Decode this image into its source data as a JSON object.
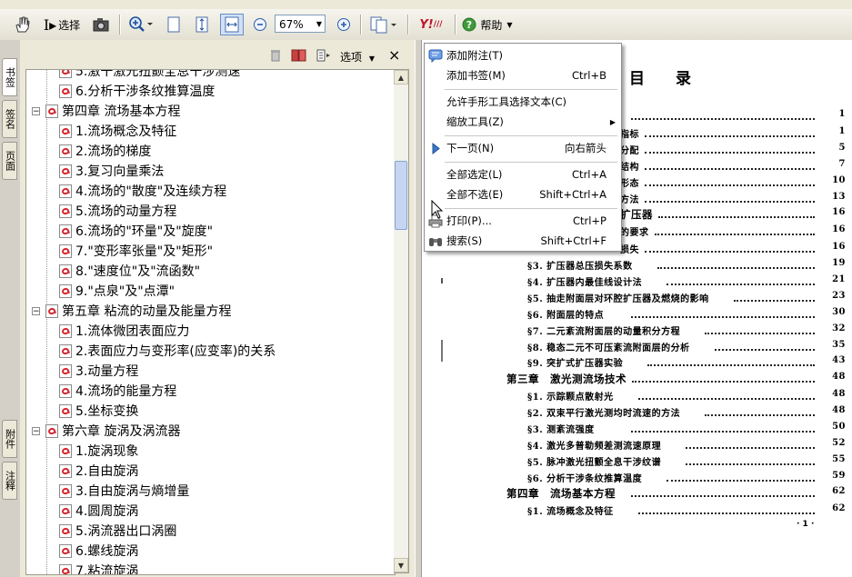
{
  "toolbar": {
    "select_label": "选择",
    "zoom_value": "67%",
    "help_label": "帮助"
  },
  "side_tabs": [
    "书签",
    "签名",
    "页面",
    "附件",
    "注释"
  ],
  "panel": {
    "options_label": "选项",
    "close_glyph": "×",
    "tree": [
      {
        "level": 1,
        "text": "5.激干激光扭颤全息干涉测速"
      },
      {
        "level": 1,
        "text": "6.分析干涉条纹推算温度"
      },
      {
        "level": 0,
        "text": "第四章 流场基本方程"
      },
      {
        "level": 1,
        "text": "1.流场概念及特征"
      },
      {
        "level": 1,
        "text": "2.流场的梯度"
      },
      {
        "level": 1,
        "text": "3.复习向量乘法"
      },
      {
        "level": 1,
        "text": "4.流场的\"散度\"及连续方程"
      },
      {
        "level": 1,
        "text": "5.流场的动量方程"
      },
      {
        "level": 1,
        "text": "6.流场的\"环量\"及\"旋度\""
      },
      {
        "level": 1,
        "text": "7.\"变形率张量\"及\"矩形\""
      },
      {
        "level": 1,
        "text": "8.\"速度位\"及\"流函数\""
      },
      {
        "level": 1,
        "text": "9.\"点泉\"及\"点潭\""
      },
      {
        "level": 0,
        "text": "第五章 粘流的动量及能量方程"
      },
      {
        "level": 1,
        "text": "1.流体微团表面应力"
      },
      {
        "level": 1,
        "text": "2.表面应力与变形率(应变率)的关系"
      },
      {
        "level": 1,
        "text": "3.动量方程"
      },
      {
        "level": 1,
        "text": "4.流场的能量方程"
      },
      {
        "level": 1,
        "text": "5.坐标变换"
      },
      {
        "level": 0,
        "text": "第六章 旋涡及涡流器"
      },
      {
        "level": 1,
        "text": "1.旋涡现象"
      },
      {
        "level": 1,
        "text": "2.自由旋涡"
      },
      {
        "level": 1,
        "text": "3.自由旋涡与熵增量"
      },
      {
        "level": 1,
        "text": "4.圆周旋涡"
      },
      {
        "level": 1,
        "text": "5.涡流器出口涡圈"
      },
      {
        "level": 1,
        "text": "6.螺线旋涡"
      },
      {
        "level": 1,
        "text": "7.粘流旋涡"
      }
    ]
  },
  "context_menu": {
    "items": [
      {
        "label": "添加附注(T)",
        "shortcut": "",
        "icon": "note-icon"
      },
      {
        "label": "添加书签(M)",
        "shortcut": "Ctrl+B"
      },
      {
        "sep": true
      },
      {
        "label": "允许手形工具选择文本(C)",
        "shortcut": ""
      },
      {
        "label": "缩放工具(Z)",
        "shortcut": "",
        "submenu": true
      },
      {
        "sep": true
      },
      {
        "label": "下一页(N)",
        "shortcut": "向右箭头",
        "icon": "next-page-icon"
      },
      {
        "sep": true
      },
      {
        "label": "全部选定(L)",
        "shortcut": "Ctrl+A"
      },
      {
        "label": "全部不选(E)",
        "shortcut": "Shift+Ctrl+A"
      },
      {
        "sep": true
      },
      {
        "label": "打印(P)...",
        "shortcut": "Ctrl+P",
        "icon": "print-icon"
      },
      {
        "label": "搜索(S)",
        "shortcut": "Shift+Ctrl+F",
        "icon": "binoculars-icon"
      }
    ]
  },
  "document": {
    "title": "目　　录",
    "toc": [
      {
        "text": "",
        "page": "1",
        "bold": false
      },
      {
        "text": "指标",
        "page": "1"
      },
      {
        "text": "分配",
        "page": "5"
      },
      {
        "text": "结构",
        "page": "7"
      },
      {
        "text": "形态",
        "page": "10"
      },
      {
        "text": "方法",
        "page": "13"
      },
      {
        "text": "扩压器",
        "page": "16",
        "chapter": true
      },
      {
        "text": "的要求",
        "page": "16"
      },
      {
        "text": "损失",
        "page": "16"
      },
      {
        "text": "§3. 扩压器总压损失系数",
        "page": "19"
      },
      {
        "text": "§4. 扩压器内最佳线设计法",
        "page": "21"
      },
      {
        "text": "§5. 抽走附面层对环腔扩压器及燃烧的影响",
        "page": "23"
      },
      {
        "text": "§6. 附面层的特点",
        "page": "30"
      },
      {
        "text": "§7. 二元紊流附面层的动量积分方程",
        "page": "32"
      },
      {
        "text": "§8. 稳态二元不可压紊流附面层的分析",
        "page": "35"
      },
      {
        "text": "§9. 突扩式扩压器实验",
        "page": "43"
      },
      {
        "text": "第三章　激光测流场技术",
        "page": "48",
        "chapter": true
      },
      {
        "text": "§1. 示踪颗点散射光",
        "page": "48"
      },
      {
        "text": "§2. 双束平行激光测均时流速的方法",
        "page": "48"
      },
      {
        "text": "§3. 测紊流强度",
        "page": "50"
      },
      {
        "text": "§4. 激光多普勒频差测流速原理",
        "page": "52"
      },
      {
        "text": "§5. 脉冲激光扭颤全息干涉纹谱",
        "page": "55"
      },
      {
        "text": "§6. 分析干涉条纹推算温度",
        "page": "59"
      },
      {
        "text": "第四章　流场基本方程",
        "page": "62",
        "chapter": true
      },
      {
        "text": "§1. 流场概念及特征",
        "page": "62"
      }
    ],
    "footer": "· 1 ·"
  }
}
